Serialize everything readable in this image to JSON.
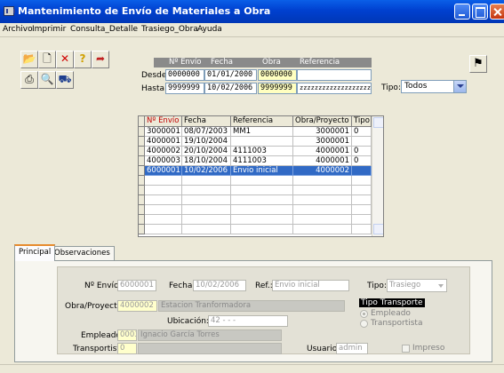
{
  "window": {
    "title": "Mantenimiento de Envío de Materiales a Obra"
  },
  "menu": [
    "Archivo",
    "Imprimir",
    "Consulta_Detalle",
    "Trasiego_Obra",
    "Ayuda"
  ],
  "toolbar": {
    "icons": [
      "open-folder-icon",
      "new-document-icon",
      "delete-icon",
      "help-icon",
      "exit-icon",
      "print-icon",
      "preview-icon",
      "truck-icon",
      "filter-icon"
    ]
  },
  "filter": {
    "headers": [
      "Nº Envío",
      "Fecha",
      "Obra",
      "Referencia"
    ],
    "desde_label": "Desde:",
    "hasta_label": "Hasta:",
    "desde": {
      "envio": "0000000",
      "fecha": "01/01/2000",
      "obra": "0000000",
      "referencia": ""
    },
    "hasta": {
      "envio": "9999999",
      "fecha": "10/02/2006",
      "obra": "9999999",
      "referencia": "zzzzzzzzzzzzzzzzzzzz"
    },
    "tipo_label": "Tipo:",
    "tipo_value": "Todos"
  },
  "grid": {
    "columns": [
      "Nº Envío",
      "Fecha",
      "Referencia",
      "Obra/Proyecto",
      "Tipo"
    ],
    "rows": [
      {
        "envio": "3000001",
        "fecha": "08/07/2003",
        "referencia": "MM1",
        "obra": "3000001",
        "tipo": "0"
      },
      {
        "envio": "4000001",
        "fecha": "19/10/2004",
        "referencia": "",
        "obra": "3000001",
        "tipo": ""
      },
      {
        "envio": "4000002",
        "fecha": "20/10/2004",
        "referencia": "4111003",
        "obra": "4000001",
        "tipo": "0"
      },
      {
        "envio": "4000003",
        "fecha": "18/10/2004",
        "referencia": "4111003",
        "obra": "4000001",
        "tipo": "0"
      },
      {
        "envio": "6000001",
        "fecha": "10/02/2006",
        "referencia": "Envio inicial",
        "obra": "4000002",
        "tipo": ""
      }
    ],
    "selected_row": 4
  },
  "tabs": [
    "Principal",
    "Observaciones"
  ],
  "detail": {
    "envio_label": "Nº Envío:",
    "envio": "6000001",
    "fecha_label": "Fecha:",
    "fecha": "10/02/2006",
    "ref_label": "Ref.:",
    "ref": "Envio inicial",
    "tipo_label": "Tipo:",
    "tipo": "Trasiego",
    "obra_label": "Obra/Proyecto:",
    "obra_code": "4000002",
    "obra_name": "Estacion Tranformadora",
    "tipo_transporte_label": "Tipo Transporte",
    "radio_empleado": "Empleado",
    "radio_transportista": "Transportista",
    "ubicacion_label": "Ubicación:",
    "ubicacion": "42  -      -      -",
    "empleado_label": "Empleado:",
    "empleado_code": "0003",
    "empleado_name": "Ignacio García Torres",
    "transportista_label": "Transportista:",
    "transportista_code": "0",
    "transportista_name": "",
    "usuario_label": "Usuario:",
    "usuario": "admin",
    "impreso_label": "Impreso"
  }
}
